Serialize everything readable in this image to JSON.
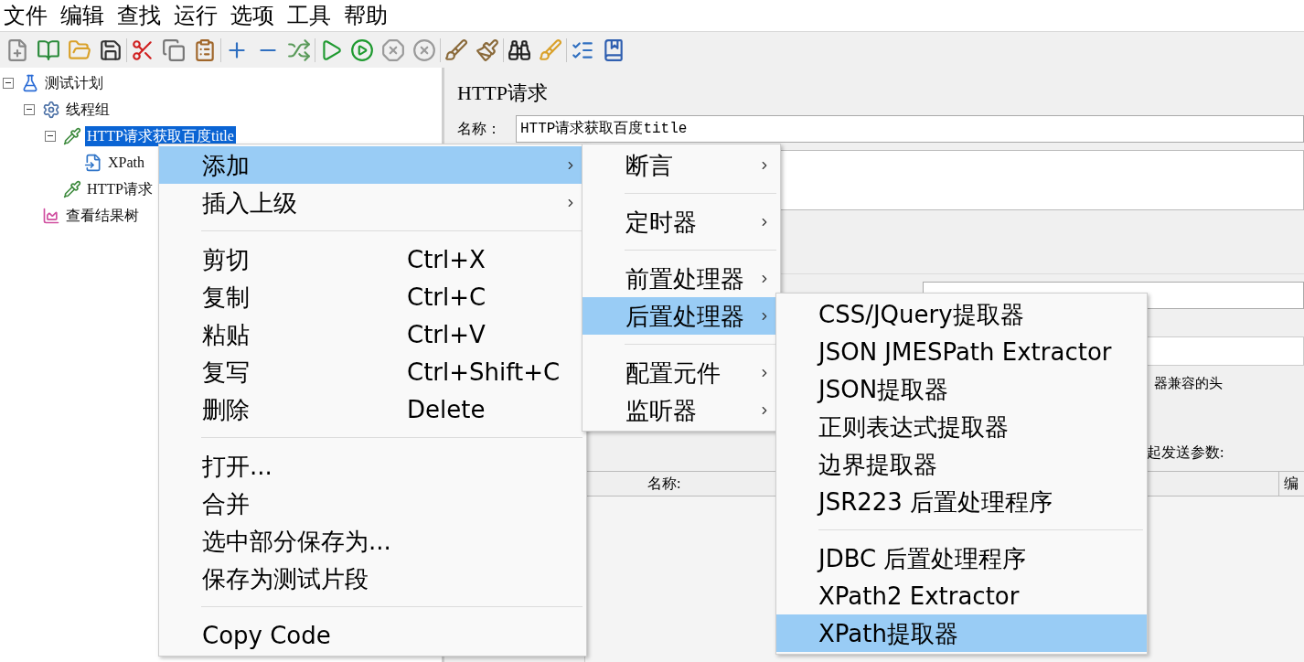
{
  "menu_bar": [
    "文件",
    "编辑",
    "查找",
    "运行",
    "选项",
    "工具",
    "帮助"
  ],
  "tree": [
    {
      "label": "测试计划",
      "kind": "plan",
      "selected": false,
      "expanded": true,
      "children": [
        {
          "label": "线程组",
          "kind": "thread_group",
          "selected": false,
          "expanded": true,
          "children": [
            {
              "label": "HTTP请求获取百度title",
              "kind": "sampler",
              "selected": true,
              "expanded": true,
              "children": [
                {
                  "label": "XPath",
                  "kind": "extractor",
                  "selected": false
                }
              ]
            },
            {
              "label": "HTTP请求",
              "kind": "sampler",
              "selected": false
            }
          ]
        },
        {
          "label": "查看结果树",
          "kind": "listener",
          "selected": false
        }
      ]
    }
  ],
  "editor": {
    "title": "HTTP请求",
    "name_label": "名称：",
    "name_value": "HTTP请求获取百度title",
    "header_note": "器兼容的头",
    "params_note": "起发送参数:",
    "table_columns": [
      "名称:",
      "编"
    ]
  },
  "context_menu": [
    {
      "kind": "item",
      "label": "添加",
      "submenu": true,
      "selected": true
    },
    {
      "kind": "item",
      "label": "插入上级",
      "submenu": true,
      "selected": false
    },
    {
      "kind": "separator"
    },
    {
      "kind": "item",
      "label": "剪切",
      "shortcut": "Ctrl+X",
      "selected": false
    },
    {
      "kind": "item",
      "label": "复制",
      "shortcut": "Ctrl+C",
      "selected": false
    },
    {
      "kind": "item",
      "label": "粘贴",
      "shortcut": "Ctrl+V",
      "selected": false
    },
    {
      "kind": "item",
      "label": "复写",
      "shortcut": "Ctrl+Shift+C",
      "selected": false
    },
    {
      "kind": "item",
      "label": "删除",
      "shortcut": "Delete",
      "selected": false
    },
    {
      "kind": "separator"
    },
    {
      "kind": "item",
      "label": "打开...",
      "selected": false
    },
    {
      "kind": "item",
      "label": "合并",
      "selected": false
    },
    {
      "kind": "item",
      "label": "选中部分保存为...",
      "selected": false
    },
    {
      "kind": "item",
      "label": "保存为测试片段",
      "selected": false
    },
    {
      "kind": "separator"
    },
    {
      "kind": "item",
      "label": "Copy Code",
      "selected": false
    }
  ],
  "add_submenu": [
    {
      "kind": "item",
      "label": "断言",
      "submenu": true,
      "selected": false
    },
    {
      "kind": "separator"
    },
    {
      "kind": "item",
      "label": "定时器",
      "submenu": true,
      "selected": false
    },
    {
      "kind": "separator"
    },
    {
      "kind": "item",
      "label": "前置处理器",
      "submenu": true,
      "selected": false
    },
    {
      "kind": "item",
      "label": "后置处理器",
      "submenu": true,
      "selected": true
    },
    {
      "kind": "separator"
    },
    {
      "kind": "item",
      "label": "配置元件",
      "submenu": true,
      "selected": false
    },
    {
      "kind": "item",
      "label": "监听器",
      "submenu": true,
      "selected": false
    }
  ],
  "post_processor_submenu": [
    {
      "kind": "item",
      "label": "CSS/JQuery提取器",
      "selected": false
    },
    {
      "kind": "item",
      "label": "JSON JMESPath Extractor",
      "selected": false
    },
    {
      "kind": "item",
      "label": "JSON提取器",
      "selected": false
    },
    {
      "kind": "item",
      "label": "正则表达式提取器",
      "selected": false
    },
    {
      "kind": "item",
      "label": "边界提取器",
      "selected": false
    },
    {
      "kind": "item",
      "label": "JSR223 后置处理程序",
      "selected": false
    },
    {
      "kind": "separator"
    },
    {
      "kind": "item",
      "label": "JDBC 后置处理程序",
      "selected": false
    },
    {
      "kind": "item",
      "label": "XPath2 Extractor",
      "selected": false
    },
    {
      "kind": "item",
      "label": "XPath提取器",
      "selected": true
    }
  ]
}
